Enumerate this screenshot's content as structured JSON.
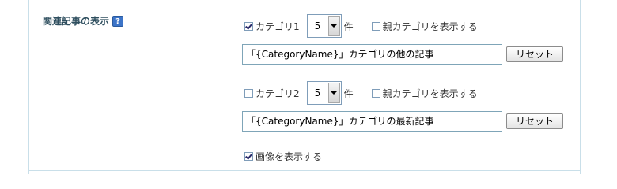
{
  "section": {
    "title": "関連記事の表示",
    "help_glyph": "?"
  },
  "category1": {
    "label": "カテゴリ1",
    "checked": true,
    "count": "5",
    "unit": "件",
    "parent_label": "親カテゴリを表示する",
    "parent_checked": false,
    "title_value": "「{CategoryName}」カテゴリの他の記事",
    "reset_label": "リセット"
  },
  "category2": {
    "label": "カテゴリ2",
    "checked": false,
    "count": "5",
    "unit": "件",
    "parent_label": "親カテゴリを表示する",
    "parent_checked": false,
    "title_value": "「{CategoryName}」カテゴリの最新記事",
    "reset_label": "リセット"
  },
  "show_image": {
    "label": "画像を表示する",
    "checked": true
  },
  "colors": {
    "border": "#c9dfe9",
    "help_icon": "#3c74c8"
  }
}
